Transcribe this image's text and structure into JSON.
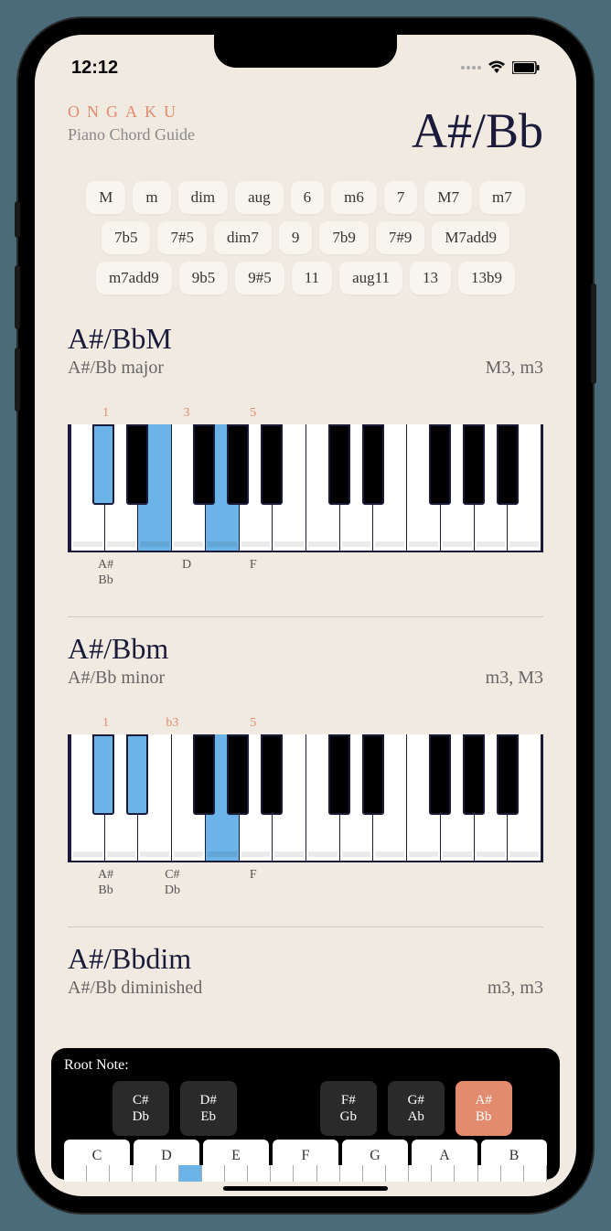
{
  "status": {
    "time": "12:12"
  },
  "brand": "ONGAKU",
  "subtitle": "Piano Chord Guide",
  "root_title": "A#/Bb",
  "chord_types": [
    "M",
    "m",
    "dim",
    "aug",
    "6",
    "m6",
    "7",
    "M7",
    "m7",
    "7b5",
    "7#5",
    "dim7",
    "9",
    "7b9",
    "7#9",
    "M7add9",
    "m7add9",
    "9b5",
    "9#5",
    "11",
    "aug11",
    "13",
    "13b9"
  ],
  "chords": [
    {
      "title": "A#/BbM",
      "subtitle": "A#/Bb major",
      "intervals": "M3, m3",
      "degrees": [
        {
          "label": "1",
          "pos": 8
        },
        {
          "label": "3",
          "pos": 25
        },
        {
          "label": "5",
          "pos": 39
        }
      ],
      "notes": [
        {
          "label": "A#\nBb",
          "pos": 8
        },
        {
          "label": "D",
          "pos": 25
        },
        {
          "label": "F",
          "pos": 39
        }
      ],
      "white_hl": [
        2,
        4
      ],
      "black_hl": [
        0
      ]
    },
    {
      "title": "A#/Bbm",
      "subtitle": "A#/Bb minor",
      "intervals": "m3, M3",
      "degrees": [
        {
          "label": "1",
          "pos": 8
        },
        {
          "label": "b3",
          "pos": 22
        },
        {
          "label": "5",
          "pos": 39
        }
      ],
      "notes": [
        {
          "label": "A#\nBb",
          "pos": 8
        },
        {
          "label": "C#\nDb",
          "pos": 22
        },
        {
          "label": "F",
          "pos": 39
        }
      ],
      "white_hl": [
        4
      ],
      "black_hl": [
        0,
        1
      ]
    },
    {
      "title": "A#/Bbdim",
      "subtitle": "A#/Bb diminished",
      "intervals": "m3, m3",
      "degrees": [],
      "notes": [],
      "white_hl": [],
      "black_hl": []
    }
  ],
  "root_picker": {
    "label": "Root Note:",
    "whites": [
      "C",
      "D",
      "E",
      "F",
      "G",
      "A",
      "B"
    ],
    "blacks": [
      {
        "top": "C#",
        "bot": "Db",
        "pos": 10,
        "selected": false
      },
      {
        "top": "D#",
        "bot": "Eb",
        "pos": 24,
        "selected": false
      },
      {
        "top": "F#",
        "bot": "Gb",
        "pos": 53,
        "selected": false
      },
      {
        "top": "G#",
        "bot": "Ab",
        "pos": 67,
        "selected": false
      },
      {
        "top": "A#",
        "bot": "Bb",
        "pos": 81,
        "selected": true
      }
    ]
  }
}
